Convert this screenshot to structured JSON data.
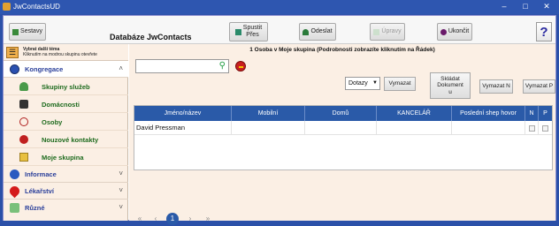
{
  "window": {
    "title": "JwContactsUD",
    "minimize": "–",
    "maximize": "□",
    "close": "✕"
  },
  "toolbar": {
    "app_title": "Databáze JwContacts",
    "sestavy": "Sestavy",
    "spustit": "Spustit Přes",
    "odeslat": "Odeslat",
    "upravy": "Úpravy",
    "ukoncit": "Ukončit",
    "help": "?"
  },
  "sidebar": {
    "hint_line1": "Vybrat další téma",
    "hint_line2": "Kliknutím na modrou skupinu otevřete",
    "sections": {
      "kongregace": "Kongregace",
      "informace": "Informace",
      "lekarstvi": "Lékařství",
      "ruzne": "Různé"
    },
    "items": {
      "skupiny": "Skupiny služeb",
      "domacnosti": "Domácnosti",
      "osoby": "Osoby",
      "nouzove": "Nouzové kontakty",
      "moje": "Moje skupina"
    }
  },
  "main": {
    "info": "1 Osoba v Moje skupina (Podrobnosti zobrazíte kliknutím na Řádek)",
    "search_value": "",
    "select_value": "Dotazy",
    "vymazat": "Vymazat",
    "skladat": "Skládat Dokument",
    "skladat_u": "u",
    "vymazat_n": "Vymazat N",
    "vymazat_p": "Vymazat P"
  },
  "grid": {
    "columns": [
      "Jméno/název",
      "Mobilní",
      "Domů",
      "KANCELÁŘ",
      "Poslední shep hovor",
      "N",
      "P"
    ],
    "rows": [
      {
        "name": "David Pressman",
        "mobile": "",
        "home": "",
        "office": "",
        "last": ""
      }
    ]
  },
  "pager": {
    "first": "«",
    "prev": "‹",
    "page": "1",
    "next": "›",
    "last": "»"
  },
  "colors": {
    "accent": "#2a5aa8",
    "sidebar_bg": "#fbefe4",
    "subitem_text": "#1e6b1e",
    "section_text": "#2a3f9a"
  }
}
